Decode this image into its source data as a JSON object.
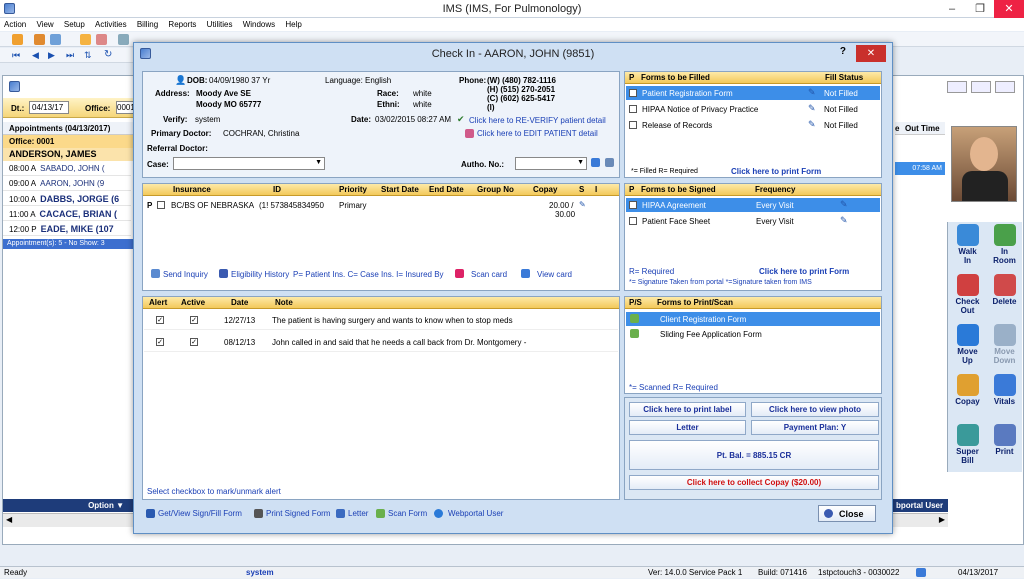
{
  "app": {
    "title": "IMS (IMS, For Pulmonology)"
  },
  "menu": [
    "Action",
    "View",
    "Setup",
    "Activities",
    "Billing",
    "Reports",
    "Utilities",
    "Windows",
    "Help"
  ],
  "schedule": {
    "date_label": "Dt.:",
    "date_value": "04/13/17",
    "office_label": "Office:",
    "office_value": "0001",
    "appointments_header": "Appointments (04/13/2017)",
    "office_row": "Office: 0001",
    "provider_row": "ANDERSON, JAMES",
    "rows": [
      {
        "time": "08:00 A",
        "name": "SABADO, JOHN (",
        "bold": false
      },
      {
        "time": "09:00 A",
        "name": "AARON, JOHN (9",
        "bold": false
      },
      {
        "time": "10:00 A",
        "name": "DABBS, JORGE (6",
        "bold": true
      },
      {
        "time": "11:00 A",
        "name": "CACACE, BRIAN (",
        "bold": true
      },
      {
        "time": "12:00 P",
        "name": "EADE, MIKE (107",
        "bold": true
      }
    ],
    "summary": "Appointment(s): 5 - No Show: 3",
    "out_time_header": "Out Time",
    "e_col_header": "e",
    "checkin_time": "07:58 AM",
    "option_label": "Option",
    "portal_user_label": "bportal User"
  },
  "dialog": {
    "title": "Check In - AARON, JOHN  (9851)",
    "help": "?",
    "close": "✕",
    "patient": {
      "dob_label": "DOB:",
      "dob": "04/09/1980  37 Yr",
      "language_label": "Language:",
      "language": "English",
      "phone_label": "Phone:",
      "phones": [
        "(W)  (480) 782-1116",
        "(H)  (515) 270-2051",
        "(C)  (602) 625-5417",
        "(I)"
      ],
      "address_label": "Address:",
      "address1": "Moody Ave SE",
      "address2": "Moody  MO  65777",
      "race_label": "Race:",
      "race": "white",
      "ethni_label": "Ethni:",
      "ethni": "white",
      "verify_label": "Verify:",
      "verify": "system",
      "date_label": "Date:",
      "date": "03/02/2015 08:27 AM",
      "reverify_link": "Click here to RE-VERIFY patient detail",
      "edit_link": "Click here to EDIT PATIENT detail",
      "primary_doctor_label": "Primary Doctor:",
      "primary_doctor": "COCHRAN, Christina",
      "referral_label": "Referral Doctor:",
      "case_label": "Case:",
      "autho_label": "Autho. No.:"
    },
    "forms_filled": {
      "headers": [
        "P",
        "Forms to be Filled",
        "Fill Status"
      ],
      "rows": [
        {
          "name": "Patient Registration Form",
          "status": "Not Filled"
        },
        {
          "name": "HIPAA Notice of Privacy Practice",
          "status": "Not Filled"
        },
        {
          "name": "Release of Records",
          "status": "Not Filled"
        }
      ],
      "legend": "*= Filled   R= Required",
      "print_link": "Click here to print Form"
    },
    "insurance": {
      "headers": [
        "Insurance",
        "ID",
        "Priority",
        "Start Date",
        "End Date",
        "Group No",
        "Copay",
        "S",
        "I"
      ],
      "rows": [
        {
          "p": "P",
          "insurance": "BC/BS OF NEBRASKA",
          "id": "(1! 573845834950",
          "priority": "Primary",
          "copay1": "20.00 /",
          "copay2": "30.00"
        }
      ],
      "send_inquiry": "Send Inquiry",
      "eligibility": "Eligibility History",
      "legend": "P= Patient Ins. C= Case Ins. I= Insured By",
      "scan_card": "Scan card",
      "view_card": "View card"
    },
    "forms_signed": {
      "headers": [
        "P",
        "Forms to be Signed",
        "Frequency"
      ],
      "rows": [
        {
          "name": "HIPAA Agreement",
          "freq": "Every Visit"
        },
        {
          "name": "Patient Face Sheet",
          "freq": "Every Visit"
        }
      ],
      "legend1": "R= Required",
      "legend2": "*= Signature Taken from portal  *=Signature taken from IMS",
      "print_link": "Click here to print Form"
    },
    "alerts": {
      "headers": [
        "Alert",
        "Active",
        "Date",
        "Note"
      ],
      "rows": [
        {
          "date": "12/27/13",
          "note": "The patient is having surgery and wants to know when to stop meds"
        },
        {
          "date": "08/12/13",
          "note": "John called in and said that he needs a call back from Dr. Montgomery -"
        }
      ],
      "footer": "Select checkbox to mark/unmark alert"
    },
    "forms_print": {
      "headers": [
        "P/S",
        "Forms to Print/Scan"
      ],
      "rows": [
        "Client Registration Form",
        "Sliding Fee Application Form"
      ],
      "legend": "*= Scanned   R= Required"
    },
    "actions": {
      "print_label": "Click here to print label",
      "view_photo": "Click here to view photo",
      "letter": "Letter",
      "payment_plan": "Payment Plan: Y",
      "pt_bal": "Pt. Bal. = 885.15 CR",
      "collect_copay": "Click here to collect Copay ($20.00)"
    },
    "bottom": {
      "get_view": "Get/View Sign/Fill Form",
      "print_signed": "Print Signed Form",
      "letter": "Letter",
      "scan_form": "Scan Form",
      "webportal": "Webportal User",
      "close": "Close"
    }
  },
  "side_buttons": [
    {
      "label1": "Walk",
      "label2": "In"
    },
    {
      "label1": "In",
      "label2": "Room"
    },
    {
      "label1": "Check",
      "label2": "Out"
    },
    {
      "label1": "Delete",
      "label2": ""
    },
    {
      "label1": "Move",
      "label2": "Up"
    },
    {
      "label1": "Move",
      "label2": "Down"
    },
    {
      "label1": "Copay",
      "label2": ""
    },
    {
      "label1": "Vitals",
      "label2": ""
    },
    {
      "label1": "Super",
      "label2": "Bill"
    },
    {
      "label1": "Print",
      "label2": ""
    }
  ],
  "status": {
    "ready": "Ready",
    "user": "system",
    "version": "Ver: 14.0.0 Service Pack 1",
    "build": "Build: 071416",
    "station": "1stpctouch3 - 0030022",
    "date": "04/13/2017"
  },
  "colors": {
    "accent": "#3d8ee8",
    "header_gold": "#f3c95a",
    "link": "#1a3fb5",
    "close_red": "#c9302c"
  }
}
